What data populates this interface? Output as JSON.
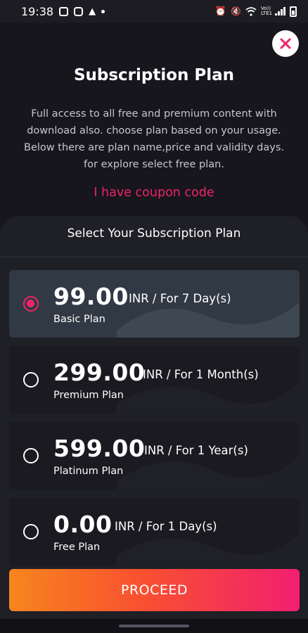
{
  "status_bar": {
    "time": "19:38",
    "left_icons": [
      "image-icon",
      "instagram-icon",
      "notification-icon",
      "dot-icon"
    ],
    "right_icons": [
      "alarm-icon",
      "mute-icon",
      "wifi-icon",
      "volte-icon",
      "signal-icon",
      "battery-icon"
    ],
    "volte_label": "Vo))\nLTE1"
  },
  "dialog": {
    "close_icon": "close-icon",
    "title": "Subscription Plan",
    "description": "Full access to all free and premium content with download also. choose plan based on your usage. Below there are plan name,price and validity days. for explore select free plan.",
    "coupon_link": "I have coupon code"
  },
  "plans_panel": {
    "title": "Select Your Subscription Plan",
    "plans": [
      {
        "price": "99.00",
        "period": "INR / For 7 Day(s)",
        "name": "Basic Plan",
        "selected": true
      },
      {
        "price": "299.00",
        "period": "INR / For 1 Month(s)",
        "name": "Premium Plan",
        "selected": false
      },
      {
        "price": "599.00",
        "period": "INR / For 1 Year(s)",
        "name": "Platinum Plan",
        "selected": false
      },
      {
        "price": "0.00",
        "period": "INR / For 1 Day(s)",
        "name": "Free Plan",
        "selected": false
      }
    ]
  },
  "proceed_button": {
    "label": "PROCEED"
  },
  "colors": {
    "accent": "#ef2468",
    "background": "#16161c",
    "panel": "#1f1f26",
    "selected_card": "#313944",
    "gradient_start": "#f7861e",
    "gradient_end": "#f21f6f"
  }
}
